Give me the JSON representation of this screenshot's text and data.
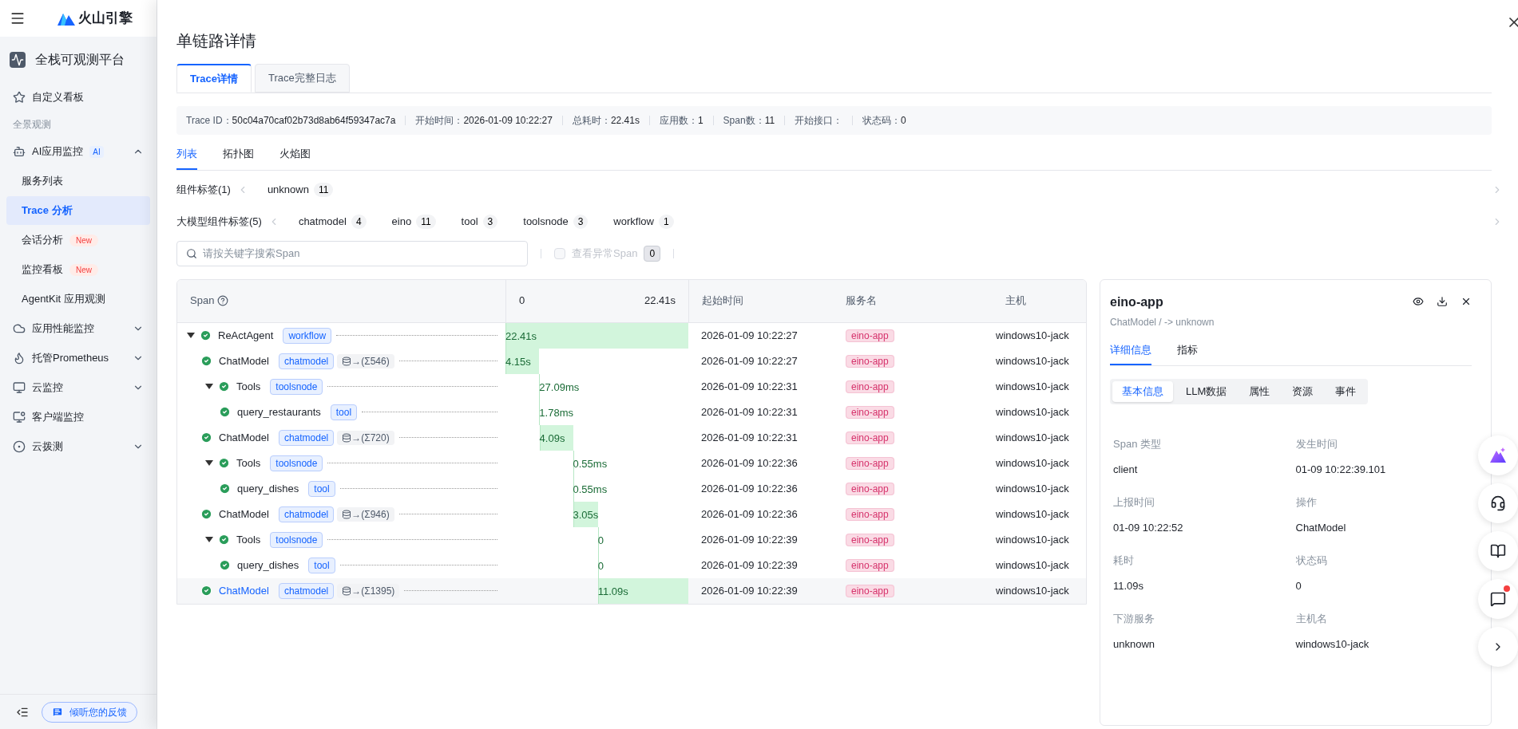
{
  "sidebar": {
    "logo": "火山引擎",
    "platform": "全栈可观测平台",
    "items": [
      {
        "kind": "item",
        "label": "自定义看板"
      },
      {
        "kind": "section",
        "label": "全景观测"
      },
      {
        "kind": "item",
        "label": "AI应用监控",
        "badge": "AI",
        "expanded": true,
        "children": [
          {
            "label": "服务列表",
            "selected": false
          },
          {
            "label": "Trace 分析",
            "selected": true
          },
          {
            "label": "会话分析",
            "badge": "New",
            "selected": false
          },
          {
            "label": "监控看板",
            "badge": "New",
            "selected": false
          },
          {
            "label": "AgentKit 应用观测",
            "selected": false
          }
        ]
      },
      {
        "kind": "item",
        "label": "应用性能监控",
        "expanded": false
      },
      {
        "kind": "item",
        "label": "托管Prometheus",
        "expanded": false
      },
      {
        "kind": "item",
        "label": "云监控",
        "expanded": false
      },
      {
        "kind": "item",
        "label": "客户端监控"
      },
      {
        "kind": "item",
        "label": "云拨测",
        "expanded": false
      }
    ],
    "feedback": "倾听您的反馈"
  },
  "drawer": {
    "title": "单链路详情",
    "tabs": [
      {
        "label": "Trace详情",
        "selected": true
      },
      {
        "label": "Trace完整日志",
        "selected": false
      }
    ],
    "info": [
      {
        "label": "Trace ID：",
        "value": "50c04a70caf02b73d8ab64f59347ac7a"
      },
      {
        "label": "开始时间：",
        "value": "2026-01-09 10:22:27"
      },
      {
        "label": "总耗时：",
        "value": "22.41s"
      },
      {
        "label": "应用数：",
        "value": "1"
      },
      {
        "label": "Span数：",
        "value": "11"
      },
      {
        "label": "开始接口："
      },
      {
        "label": "状态码：",
        "value": "0"
      }
    ],
    "view_tabs": [
      {
        "label": "列表",
        "selected": true
      },
      {
        "label": "拓扑图",
        "selected": false
      },
      {
        "label": "火焰图",
        "selected": false
      }
    ],
    "tag_groups": [
      {
        "label": "组件标签(1)",
        "tags": [
          {
            "name": "unknown",
            "count": "11"
          }
        ]
      },
      {
        "label": "大模型组件标签(5)",
        "tags": [
          {
            "name": "chatmodel",
            "count": "4"
          },
          {
            "name": "eino",
            "count": "11"
          },
          {
            "name": "tool",
            "count": "3"
          },
          {
            "name": "toolsnode",
            "count": "3"
          },
          {
            "name": "workflow",
            "count": "1"
          }
        ]
      }
    ],
    "search": {
      "placeholder": "请按关键字搜索Span"
    },
    "anomaly": {
      "label": "查看异常Span",
      "count": "0",
      "checked": false
    },
    "table": {
      "columns": {
        "span": "Span",
        "timeline_start": "0",
        "timeline_end": "22.41s",
        "start_time": "起始时间",
        "service": "服务名",
        "host": "主机"
      },
      "rows": [
        {
          "name": "ReActAgent",
          "type": "workflow",
          "duration": "22.41s",
          "level": 1,
          "start_time": "2026-01-09 10:22:27",
          "service": "eino-app",
          "host": "windows10-jack",
          "expanded": true,
          "selected": false,
          "children": [
            {
              "name": "ChatModel",
              "type": "chatmodel",
              "tokens": "→(Σ546)",
              "duration": "4.15s",
              "level": 0.185,
              "start_time": "2026-01-09 10:22:27",
              "service": "eino-app",
              "host": "windows10-jack",
              "selected": false
            },
            {
              "name": "Tools",
              "type": "toolsnode",
              "duration": "27.09ms",
              "level": 0.001,
              "start_time": "2026-01-09 10:22:31",
              "service": "eino-app",
              "host": "windows10-jack",
              "expanded": true,
              "selected": false,
              "children": [
                {
                  "name": "query_restaurants",
                  "type": "tool",
                  "duration": "1.78ms",
                  "level": 0.0001,
                  "start_time": "2026-01-09 10:22:31",
                  "service": "eino-app",
                  "host": "windows10-jack",
                  "selected": false
                }
              ]
            },
            {
              "name": "ChatModel",
              "type": "chatmodel",
              "tokens": "→(Σ720)",
              "duration": "4.09s",
              "level": 0.183,
              "start_time": "2026-01-09 10:22:31",
              "service": "eino-app",
              "host": "windows10-jack",
              "selected": false
            },
            {
              "name": "Tools",
              "type": "toolsnode",
              "duration": "0.55ms",
              "level": 0,
              "start_time": "2026-01-09 10:22:36",
              "service": "eino-app",
              "host": "windows10-jack",
              "expanded": true,
              "selected": false,
              "children": [
                {
                  "name": "query_dishes",
                  "type": "tool",
                  "duration": "0.55ms",
                  "level": 0,
                  "start_time": "2026-01-09 10:22:36",
                  "service": "eino-app",
                  "host": "windows10-jack",
                  "selected": false
                }
              ]
            },
            {
              "name": "ChatModel",
              "type": "chatmodel",
              "tokens": "→(Σ946)",
              "duration": "3.05s",
              "level": 0.136,
              "start_time": "2026-01-09 10:22:36",
              "service": "eino-app",
              "host": "windows10-jack",
              "selected": false
            },
            {
              "name": "Tools",
              "type": "toolsnode",
              "duration": "0",
              "level": 0,
              "start_time": "2026-01-09 10:22:39",
              "service": "eino-app",
              "host": "windows10-jack",
              "expanded": true,
              "selected": false,
              "children": [
                {
                  "name": "query_dishes",
                  "type": "tool",
                  "duration": "0",
                  "level": 0,
                  "start_time": "2026-01-09 10:22:39",
                  "service": "eino-app",
                  "host": "windows10-jack",
                  "selected": false
                }
              ]
            },
            {
              "name": "ChatModel",
              "type": "chatmodel",
              "tokens": "→(Σ1395)",
              "duration": "11.09s",
              "level": 0.495,
              "start_time": "2026-01-09 10:22:39",
              "service": "eino-app",
              "host": "windows10-jack",
              "selected": true
            }
          ]
        }
      ]
    },
    "detail": {
      "title": "eino-app",
      "subtitle": "ChatModel / -> unknown",
      "tabs": [
        {
          "label": "详细信息",
          "selected": true
        },
        {
          "label": "指标",
          "selected": false
        }
      ],
      "sub_tabs": [
        {
          "label": "基本信息",
          "selected": true
        },
        {
          "label": "LLM数据",
          "selected": false
        },
        {
          "label": "属性",
          "selected": false
        },
        {
          "label": "资源",
          "selected": false
        },
        {
          "label": "事件",
          "selected": false
        }
      ],
      "fields": [
        {
          "label": "Span 类型",
          "value": "client"
        },
        {
          "label": "发生时间",
          "value": "01-09 10:22:39.101"
        },
        {
          "label": "上报时间",
          "value": "01-09 10:22:52"
        },
        {
          "label": "操作",
          "value": "ChatModel"
        },
        {
          "label": "耗时",
          "value": "11.09s"
        },
        {
          "label": "状态码",
          "value": "0"
        },
        {
          "label": "下游服务",
          "value": "unknown"
        },
        {
          "label": "主机名",
          "value": "windows10-jack"
        }
      ]
    }
  }
}
